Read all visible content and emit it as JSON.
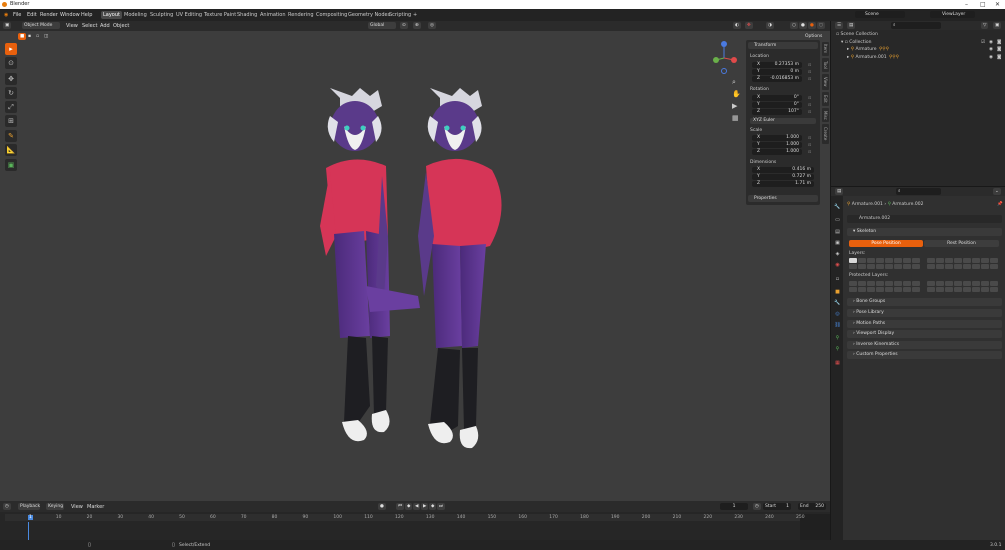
{
  "window": {
    "title": "Blender"
  },
  "menubar": {
    "menus": [
      "File",
      "Edit",
      "Render",
      "Window",
      "Help"
    ],
    "workspaces": [
      "Layout",
      "Modeling",
      "Sculpting",
      "UV Editing",
      "Texture Paint",
      "Shading",
      "Animation",
      "Rendering",
      "Compositing",
      "Geometry Nodes",
      "Scripting"
    ],
    "active_workspace": "Layout",
    "add_tab": "+",
    "scene_label": "Scene",
    "viewlayer_label": "ViewLayer"
  },
  "viewport_header": {
    "mode": "Object Mode",
    "menus": [
      "View",
      "Select",
      "Add",
      "Object"
    ],
    "orientation": "Global",
    "options": "Options"
  },
  "npanel": {
    "transform_title": "Transform",
    "location_label": "Location",
    "location": [
      {
        "axis": "X",
        "value": "0.27353 m"
      },
      {
        "axis": "Y",
        "value": "0 m"
      },
      {
        "axis": "Z",
        "value": "-0.016853 m"
      }
    ],
    "rotation_label": "Rotation",
    "rotation": [
      {
        "axis": "X",
        "value": "0°"
      },
      {
        "axis": "Y",
        "value": "0°"
      },
      {
        "axis": "Z",
        "value": "107°"
      }
    ],
    "rotation_mode": "XYZ Euler",
    "scale_label": "Scale",
    "scale": [
      {
        "axis": "X",
        "value": "1.000"
      },
      {
        "axis": "Y",
        "value": "1.000"
      },
      {
        "axis": "Z",
        "value": "1.000"
      }
    ],
    "dimensions_label": "Dimensions",
    "dimensions": [
      {
        "axis": "X",
        "value": "0.416 m"
      },
      {
        "axis": "Y",
        "value": "0.727 m"
      },
      {
        "axis": "Z",
        "value": "1.71 m"
      }
    ],
    "properties_title": "Properties",
    "side_tabs": [
      "Item",
      "Tool",
      "View",
      "Edit",
      "Misc",
      "Create"
    ]
  },
  "timeline": {
    "menus": [
      "Playback",
      "Keying",
      "View",
      "Marker"
    ],
    "current_frame": "1",
    "start_label": "Start",
    "start": "1",
    "end_label": "End",
    "end": "250",
    "ticks": [
      "1",
      "10",
      "20",
      "30",
      "40",
      "50",
      "60",
      "70",
      "80",
      "90",
      "100",
      "110",
      "120",
      "130",
      "140",
      "150",
      "160",
      "170",
      "180",
      "190",
      "200",
      "210",
      "220",
      "230",
      "240",
      "250"
    ]
  },
  "outliner": {
    "rows": [
      "Scene Collection",
      "Collection",
      "Armature",
      "Armature.001"
    ]
  },
  "properties": {
    "breadcrumb_a": "Armature.001",
    "breadcrumb_b": "Armature.002",
    "datablock": "Armature.002",
    "skeleton_title": "Skeleton",
    "pose_position": "Pose Position",
    "rest_position": "Rest Position",
    "layers_label": "Layers:",
    "protected_label": "Protected Layers:",
    "sections": [
      "Bone Groups",
      "Pose Library",
      "Motion Paths",
      "Viewport Display",
      "Inverse Kinematics",
      "Custom Properties"
    ]
  },
  "statusbar": {
    "left_hint": "Select/Extend",
    "version": "3.0.1"
  },
  "colors": {
    "accent": "#e8600d",
    "panel": "#2b2b2b",
    "viewport": "#3d3d3d",
    "title_bar": "#ffffff"
  }
}
